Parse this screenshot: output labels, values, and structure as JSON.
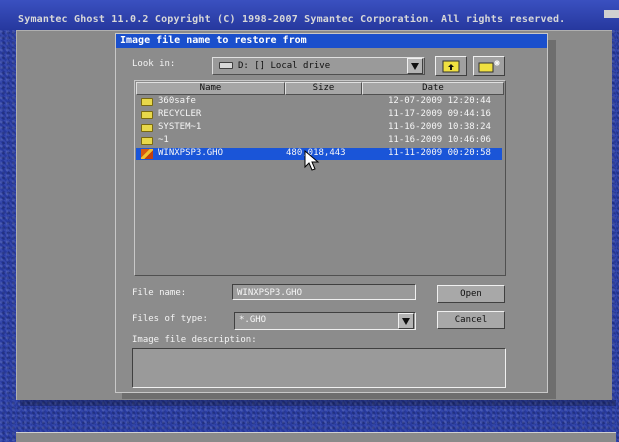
{
  "app": {
    "title": "Symantec Ghost 11.0.2   Copyright (C) 1998-2007 Symantec Corporation. All rights reserved."
  },
  "dialog": {
    "title": "Image file name to restore from",
    "look_in_label": "Look in:",
    "look_in_value": "D: [] Local drive",
    "columns": {
      "name": "Name",
      "size": "Size",
      "date": "Date"
    },
    "rows": [
      {
        "name": "360safe",
        "size": "",
        "date": "12-07-2009 12:20:44",
        "type": "folder"
      },
      {
        "name": "RECYCLER",
        "size": "",
        "date": "11-17-2009 09:44:16",
        "type": "folder"
      },
      {
        "name": "SYSTEM~1",
        "size": "",
        "date": "11-16-2009 10:38:24",
        "type": "folder"
      },
      {
        "name": "~1",
        "size": "",
        "date": "11-16-2009 10:46:06",
        "type": "folder"
      },
      {
        "name": "WINXPSP3.GHO",
        "size": "480,018,443",
        "date": "11-11-2009 00:20:58",
        "type": "image",
        "selected": true
      }
    ],
    "file_name_label": "File name:",
    "file_name_value": "WINXPSP3.GHO",
    "files_of_type_label": "Files of type:",
    "files_of_type_value": "*.GHO",
    "description_label": "Image file description:",
    "open_label": "Open",
    "cancel_label": "Cancel"
  },
  "colors": {
    "desktop": "#2a3ea8",
    "dialog_title": "#1a4fcc",
    "selection": "#1a55d8",
    "window": "#8c8c8c"
  },
  "icons": {
    "drive": "hard-drive-icon",
    "up": "folder-up-icon",
    "new_folder": "new-folder-icon",
    "folder": "folder-icon",
    "image_file": "ghost-image-file-icon"
  }
}
